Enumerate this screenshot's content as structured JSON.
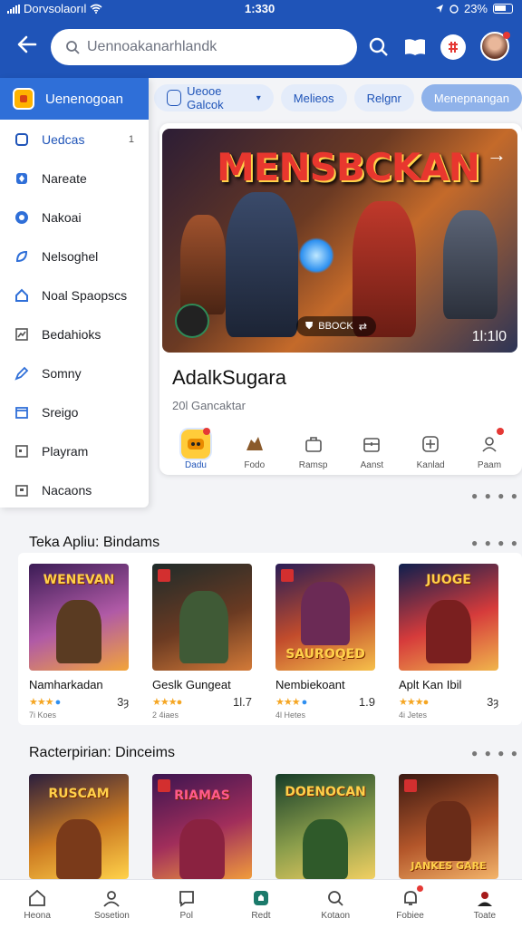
{
  "status_bar": {
    "carrier": "Dorvsolaorıl",
    "time": "1:330",
    "battery": "23%"
  },
  "header": {
    "search_placeholder": "Uennoakanarhlandk"
  },
  "sidebar": {
    "title": "Uenenogoan",
    "items": [
      {
        "label": "Uedcas",
        "icon": "square-icon",
        "badge": "1"
      },
      {
        "label": "Nareate",
        "icon": "diamond-icon"
      },
      {
        "label": "Nakoai",
        "icon": "circle-icon"
      },
      {
        "label": "Nelsoghel",
        "icon": "leaf-icon"
      },
      {
        "label": "Noal Spaopscs",
        "icon": "home-icon"
      },
      {
        "label": "Bedahioks",
        "icon": "chart-icon"
      },
      {
        "label": "Somny",
        "icon": "pen-icon"
      },
      {
        "label": "Sreigo",
        "icon": "calendar-icon"
      },
      {
        "label": "Playram",
        "icon": "window-icon"
      },
      {
        "label": "Nacaons",
        "icon": "box-icon"
      }
    ]
  },
  "chips": [
    {
      "label": "Ueooe Galcok"
    },
    {
      "label": "Melieos"
    },
    {
      "label": "Relgnr"
    },
    {
      "label": "Menepnangan"
    }
  ],
  "feature": {
    "banner_title": "MENSBCKAN",
    "banner_pill": "BBOCK",
    "banner_counter": "1Ɩ:1Ɩ0",
    "title": "AdalkSugara",
    "subtitle": "20Ɩ Gancaktar",
    "categories": [
      {
        "label": "Dadu",
        "icon": "mask-icon"
      },
      {
        "label": "Fodo",
        "icon": "dragon-icon"
      },
      {
        "label": "Ramsp",
        "icon": "bag-icon"
      },
      {
        "label": "Aanst",
        "icon": "chest-icon"
      },
      {
        "label": "Kanlad",
        "icon": "globe-icon"
      },
      {
        "label": "Paam",
        "icon": "person-icon"
      }
    ]
  },
  "section1": {
    "title": "Teka Apliu: Bindams",
    "tiles": [
      {
        "name": "Namharkadan",
        "rating": "3.9",
        "num": "3ȝ",
        "downloads": "7i Koes",
        "art_title": "WENEVAN",
        "colors": [
          "#3b1c55",
          "#b05aa6",
          "#f2a43a"
        ]
      },
      {
        "name": "Geslk Gungeat",
        "rating": "4.0",
        "num": "1Ɩ.7",
        "downloads": "2 4iaes",
        "art_title": "",
        "colors": [
          "#1f2b2a",
          "#6a3a22",
          "#d37a38"
        ]
      },
      {
        "name": "Nembiekoant",
        "rating": "4.1",
        "num": "1.9",
        "downloads": "4Ɩ Hetes",
        "art_title": "SAUROQED",
        "colors": [
          "#2a1d56",
          "#c24c2c",
          "#f6c04a"
        ]
      },
      {
        "name": "Aplt Kan Ibil",
        "rating": "4.0",
        "num": "3ȝ",
        "downloads": "4i Jetes",
        "art_title": "JUOGE",
        "colors": [
          "#0e1f4e",
          "#d63b3b",
          "#f0b54c"
        ]
      }
    ]
  },
  "section2": {
    "title": "Racterpirian: Dinceims",
    "tiles": [
      {
        "art_title": "RUSCAM",
        "colors": [
          "#2a1e3d",
          "#cc7a22",
          "#ffd24a"
        ]
      },
      {
        "art_title": "RIAMAS",
        "colors": [
          "#3b1450",
          "#a12e5b",
          "#f09c3c"
        ]
      },
      {
        "art_title": "DOENOCAN",
        "colors": [
          "#163c28",
          "#8a9d4b",
          "#f1cf62"
        ]
      },
      {
        "art_title": "JANKES GARE",
        "colors": [
          "#3a1812",
          "#b3562a",
          "#f3b46a"
        ]
      }
    ]
  },
  "bottom_nav": [
    {
      "label": "Heona",
      "icon": "home-icon"
    },
    {
      "label": "Sosetion",
      "icon": "person-icon"
    },
    {
      "label": "Pol",
      "icon": "chat-icon"
    },
    {
      "label": "Redt",
      "icon": "shield-icon"
    },
    {
      "label": "Kotaon",
      "icon": "search-icon"
    },
    {
      "label": "Fobiee",
      "icon": "bell-icon"
    },
    {
      "label": "Toate",
      "icon": "profile-icon"
    }
  ]
}
